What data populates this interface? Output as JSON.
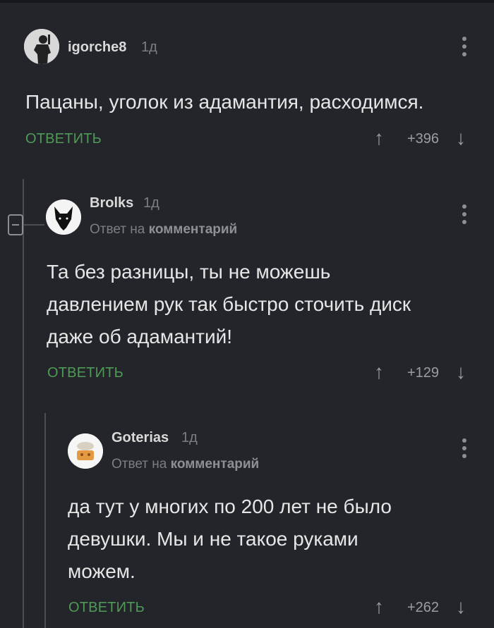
{
  "comments": [
    {
      "author": "igorche8",
      "time": "1д",
      "text": "Пацаны, уголок из адамантия, расходимся.",
      "reply_label": "ОТВЕТИТЬ",
      "rating": "+396",
      "upvote_icon": "arrow-up-icon",
      "downvote_icon": "arrow-down-icon"
    },
    {
      "author": "Brolks",
      "time": "1д",
      "reply_to_prefix": "Ответ на",
      "reply_to_link": "комментарий",
      "text_lines": [
        "Та без разницы, ты не можешь",
        "давлением рук так быстро сточить диск",
        "даже об адамантий!"
      ],
      "reply_label": "ОТВЕТИТЬ",
      "rating": "+129"
    },
    {
      "author": "Goterias",
      "time": "1д",
      "reply_to_prefix": "Ответ на",
      "reply_to_link": "комментарий",
      "text_lines": [
        "да тут у многих по 200 лет не было",
        "девушки. Мы и не такое руками",
        "можем."
      ],
      "reply_label": "ОТВЕТИТЬ",
      "rating": "+262"
    }
  ],
  "colors": {
    "background": "#23252a",
    "accent_green": "#4f9a57",
    "muted": "#7b7e83"
  }
}
